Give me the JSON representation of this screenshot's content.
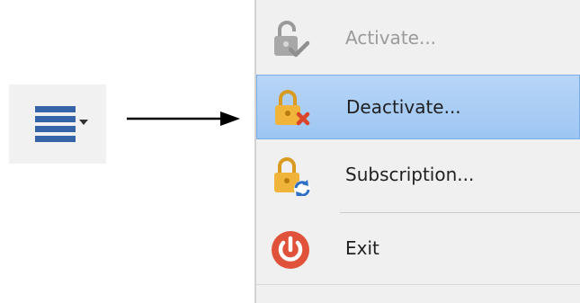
{
  "menu_button": {
    "icon": "hamburger-menu-icon",
    "color": "#3565a8"
  },
  "menu": {
    "items": [
      {
        "label": "Activate...",
        "icon": "lock-open-check-icon",
        "state": "disabled"
      },
      {
        "label": "Deactivate...",
        "icon": "lock-x-icon",
        "state": "highlighted"
      },
      {
        "label": "Subscription...",
        "icon": "lock-refresh-icon",
        "state": "normal"
      },
      {
        "label": "Exit",
        "icon": "power-icon",
        "state": "normal"
      }
    ]
  },
  "colors": {
    "highlight": "#9ec6f3",
    "lock_gold": "#f0b43a",
    "power_red": "#e0533a",
    "refresh_blue": "#2f6fc6",
    "x_red": "#d9442b"
  }
}
